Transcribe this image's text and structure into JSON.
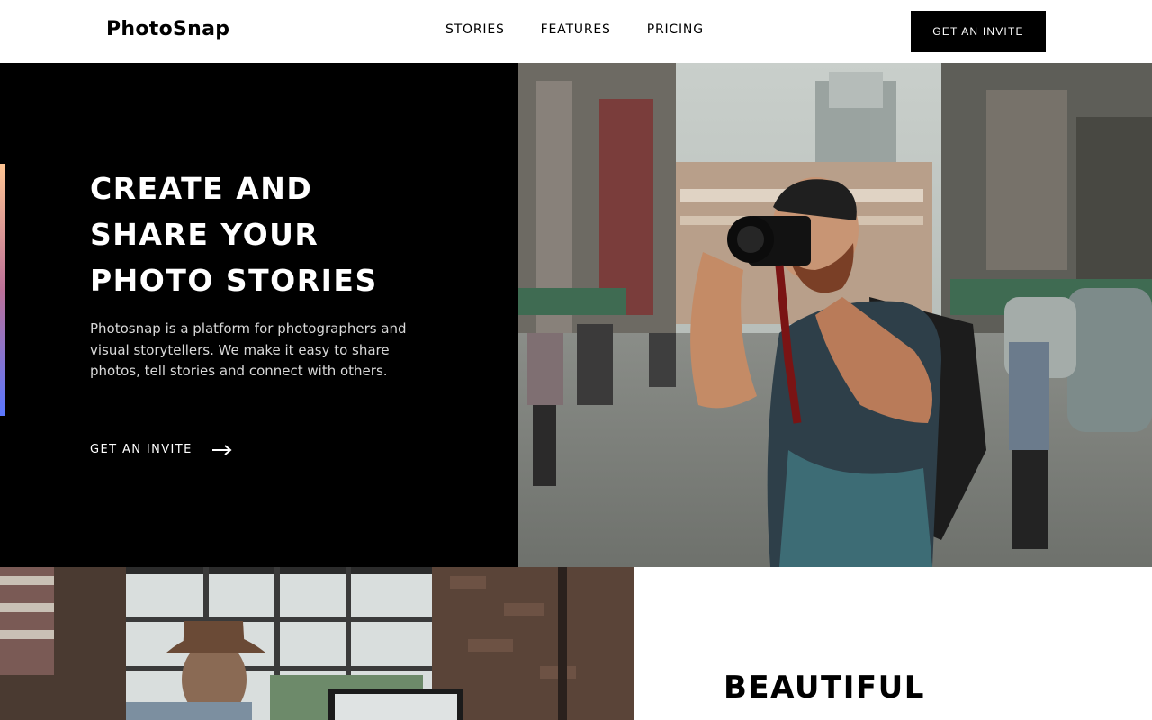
{
  "header": {
    "logo": "PhotoSnap",
    "nav": [
      "STORIES",
      "FEATURES",
      "PRICING"
    ],
    "invite_button": "GET AN INVITE"
  },
  "hero": {
    "title_lines": [
      "CREATE AND",
      "SHARE YOUR",
      "PHOTO STORIES"
    ],
    "description": "Photosnap is a platform for photographers and visual storytellers. We make it easy to share photos, tell stories and connect with others.",
    "cta_label": "GET AN INVITE",
    "cta_icon": "arrow-right-icon",
    "accent_gradient": [
      "#ffc593",
      "#bc7198",
      "#5a77ff"
    ]
  },
  "feature": {
    "title": "BEAUTIFUL"
  },
  "colors": {
    "primary": "#000000",
    "background": "#ffffff"
  }
}
